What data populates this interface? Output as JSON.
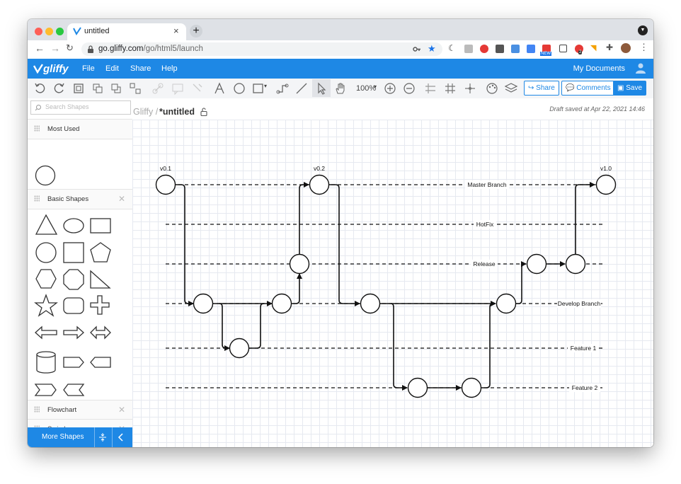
{
  "browser": {
    "tab_title": "untitled",
    "url_host": "go.gliffy.com",
    "url_path": "/go/html5/launch",
    "new_badge": "NEW",
    "ext_badge": "2"
  },
  "app": {
    "logo": "gliffy",
    "menu": [
      "File",
      "Edit",
      "Share",
      "Help"
    ],
    "my_documents": "My Documents"
  },
  "toolbar": {
    "zoom": "100%",
    "share_label": "Share",
    "comments_label": "Comments",
    "save_label": "Save"
  },
  "sidebar": {
    "search_placeholder": "Search Shapes",
    "sections": [
      "Most Used",
      "Basic Shapes",
      "Flowchart",
      "Swimlanes"
    ],
    "more_shapes": "More Shapes"
  },
  "document": {
    "breadcrumb_root": "Gliffy /",
    "title": "*untitled",
    "draft_status": "Draft saved at Apr 22, 2021 14:46"
  },
  "diagram": {
    "versions": [
      "v0.1",
      "v0.2",
      "v1.0"
    ],
    "lanes": [
      "Master Branch",
      "HotFix",
      "Release",
      "Develop Branch",
      "Feature 1",
      "Feature 2"
    ]
  },
  "colors": {
    "brand_blue": "#1e88e5",
    "tabstrip": "#dee1e6",
    "traffic_red": "#fe5f57",
    "traffic_yellow": "#febc2e",
    "traffic_green": "#28c840"
  }
}
